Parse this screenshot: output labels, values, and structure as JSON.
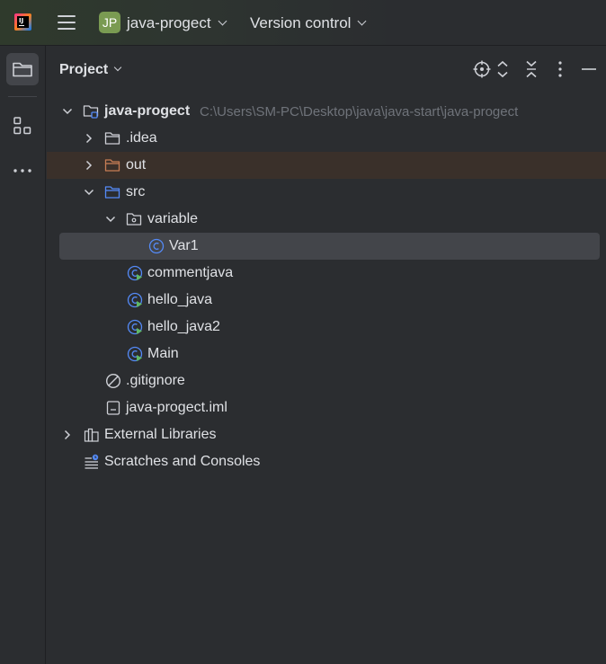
{
  "titlebar": {
    "project_initials": "JP",
    "project_name": "java-progect",
    "vcs_label": "Version control",
    "brand_color": "#7a9b52"
  },
  "toolstrip": {
    "items": [
      {
        "name": "project",
        "icon": "folder-icon",
        "active": true
      },
      {
        "name": "structure",
        "icon": "structure-icon",
        "active": false
      },
      {
        "name": "more",
        "icon": "more-icon",
        "active": false
      }
    ]
  },
  "panel": {
    "title": "Project",
    "actions": [
      "locate-icon",
      "expand-all-icon",
      "collapse-all-icon",
      "options-icon",
      "hide-icon"
    ]
  },
  "tree": {
    "root": {
      "label": "java-progect",
      "path": "C:\\Users\\SM-PC\\Desktop\\java\\java-start\\java-progect"
    },
    "idea": {
      "label": ".idea"
    },
    "out": {
      "label": "out"
    },
    "src": {
      "label": "src"
    },
    "variable": {
      "label": "variable"
    },
    "var1": {
      "label": "Var1"
    },
    "commentjava": {
      "label": "commentjava"
    },
    "hello_java": {
      "label": "hello_java"
    },
    "hello_java2": {
      "label": "hello_java2"
    },
    "main": {
      "label": "Main"
    },
    "gitignore": {
      "label": ".gitignore"
    },
    "iml": {
      "label": "java-progect.iml"
    },
    "external": {
      "label": "External Libraries"
    },
    "scratches": {
      "label": "Scratches and Consoles"
    }
  },
  "colors": {
    "background": "#2b2d30",
    "selection": "#43454a",
    "excluded_row": "#3a302a",
    "class_icon": "#548af7",
    "excluded_folder": "#c77d55"
  }
}
